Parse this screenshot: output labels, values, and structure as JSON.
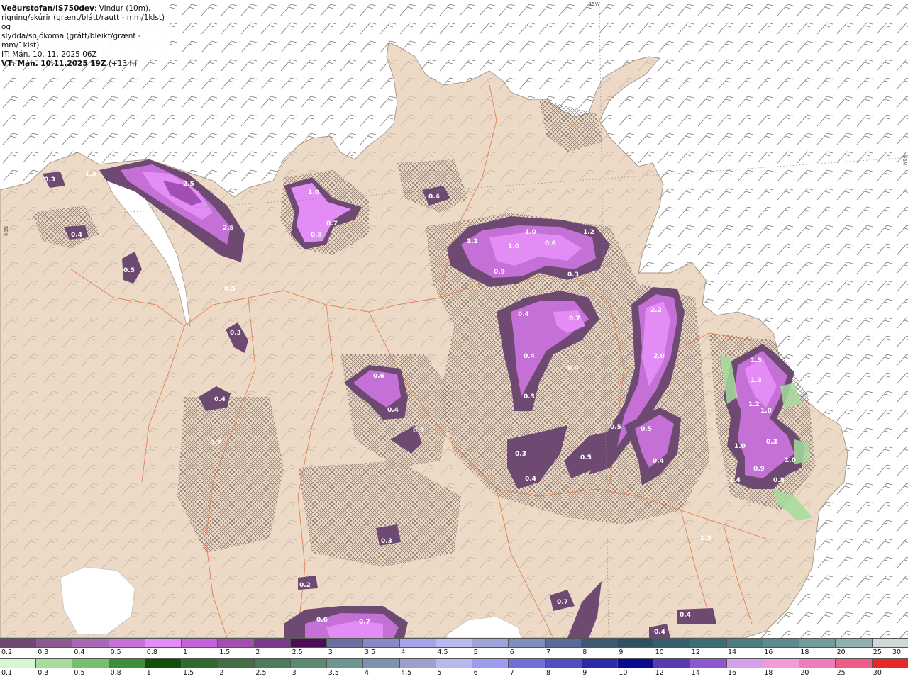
{
  "header": {
    "brand": "Veðurstofan/IS750dev",
    "desc1": ": Vindur (10m),",
    "desc2": "rigning/skúrir (grænt/blátt/rautt - mm/1klst) og",
    "desc3": "slydda/snjókoma (grátt/bleikt/grænt - mm/1klst)",
    "it_line": "IT: Mán. 10. 11. 2025 06Z",
    "vt_bold": "VT: Mán. 10.11.2025 19Z",
    "vt_rest": " (+13 h)"
  },
  "grid_labels": {
    "top_lon": "15W",
    "left_lat": "66N",
    "right_lat": "66N"
  },
  "colors": {
    "sea": "#ffffff",
    "land": "#ecd9c6",
    "land_edge": "#a89888",
    "roads": "#e07848",
    "lake": "#ffffff",
    "precip_accent": "#e066f0"
  },
  "precip_labels": [
    "0.3",
    "1.3",
    "2.5",
    "2.5",
    "1.0",
    "0.7",
    "0.8",
    "0.4",
    "0.5",
    "1.0",
    "1.0",
    "0.6",
    "1.2",
    "1.2",
    "0.9",
    "0.3",
    "0.5",
    "0.3",
    "0.4",
    "0.4",
    "0.7",
    "0.4",
    "0.4",
    "0.3",
    "2.2",
    "2.0",
    "0.6",
    "0.4",
    "0.3",
    "0.5",
    "0.5",
    "0.2",
    "0.3",
    "0.5",
    "0.4",
    "0.4",
    "1.5",
    "1.3",
    "1.2",
    "1.0",
    "1.0",
    "0.9",
    "1.0",
    "0.8",
    "1.4",
    "0.4",
    "0.3",
    "0.2",
    "0.7",
    "0.6",
    "0.7",
    "0.4",
    "0.4",
    "0.3",
    "1.5"
  ],
  "legend_snow": {
    "labels": [
      "0.2",
      "0.3",
      "0.4",
      "0.5",
      "0.8",
      "1",
      "1.5",
      "2",
      "2.5",
      "3",
      "3.5",
      "4",
      "4.5",
      "5",
      "6",
      "7",
      "8",
      "9",
      "10",
      "12",
      "14",
      "16",
      "18",
      "20",
      "25",
      "30"
    ],
    "colors": [
      "#6e4a72",
      "#8a5a90",
      "#a868b4",
      "#c470d6",
      "#e48cf5",
      "#c462d9",
      "#a24fb3",
      "#7a3a88",
      "#4a0f52",
      "#6a6f9e",
      "#8789c4",
      "#a3a5e6",
      "#b8baf0",
      "#9ea4d8",
      "#7f8dbf",
      "#5a6b96",
      "#3e5872",
      "#2f5060",
      "#355f6a",
      "#3e6c74",
      "#4c7d80",
      "#5e8c8c",
      "#739c9c",
      "#8eb0b0",
      "#cfd8d8"
    ]
  },
  "legend_rain": {
    "labels": [
      "0.1",
      "0.3",
      "0.5",
      "0.8",
      "1",
      "1.5",
      "2",
      "2.5",
      "3",
      "3.5",
      "4",
      "4.5",
      "5",
      "6",
      "7",
      "8",
      "9",
      "10",
      "12",
      "14",
      "16",
      "18",
      "20",
      "25",
      "30"
    ],
    "colors": [
      "#d6f7d4",
      "#a6dc9c",
      "#76bf6c",
      "#3f8f3a",
      "#0f4f0a",
      "#2e6a2e",
      "#446e46",
      "#4c7c5a",
      "#5a8a72",
      "#6e9690",
      "#8090b0",
      "#9ca0cc",
      "#b8b8ec",
      "#9c9cec",
      "#7070d4",
      "#4f4fc0",
      "#2a2aa8",
      "#0a0a90",
      "#5a3ab0",
      "#8c58cc",
      "#d4a0ea",
      "#f49ad8",
      "#f07cc0",
      "#f05c88",
      "#e62828"
    ]
  }
}
